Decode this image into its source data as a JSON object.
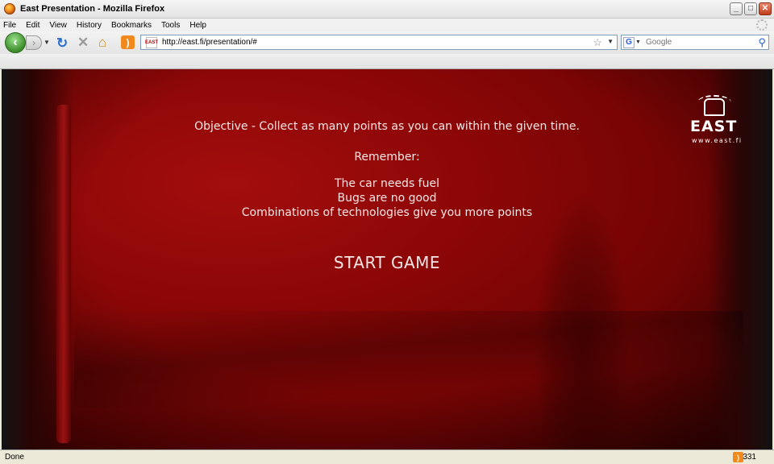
{
  "window": {
    "title": "East Presentation - Mozilla Firefox",
    "minimize_label": "_",
    "maximize_label": "□",
    "close_label": "✕"
  },
  "menu": {
    "items": [
      "File",
      "Edit",
      "View",
      "History",
      "Bookmarks",
      "Tools",
      "Help"
    ]
  },
  "toolbar": {
    "url": "http://east.fi/presentation/#",
    "search_placeholder": "Google",
    "icons": [
      "back-icon",
      "forward-icon",
      "reload-icon",
      "stop-icon",
      "home-icon",
      "rss-icon",
      "star-icon",
      "search-icon"
    ]
  },
  "page": {
    "objective": "Objective - Collect as many points as you can within the given time.",
    "remember": "Remember:",
    "rules": [
      "The car needs fuel",
      "Bugs are no good",
      "Combinations of technologies give you more points"
    ],
    "start_label": "START GAME",
    "logo_word": "EAST",
    "logo_url": "www.east.fi",
    "accent": "#8a0606"
  },
  "status": {
    "text": "Done",
    "count": "331"
  }
}
